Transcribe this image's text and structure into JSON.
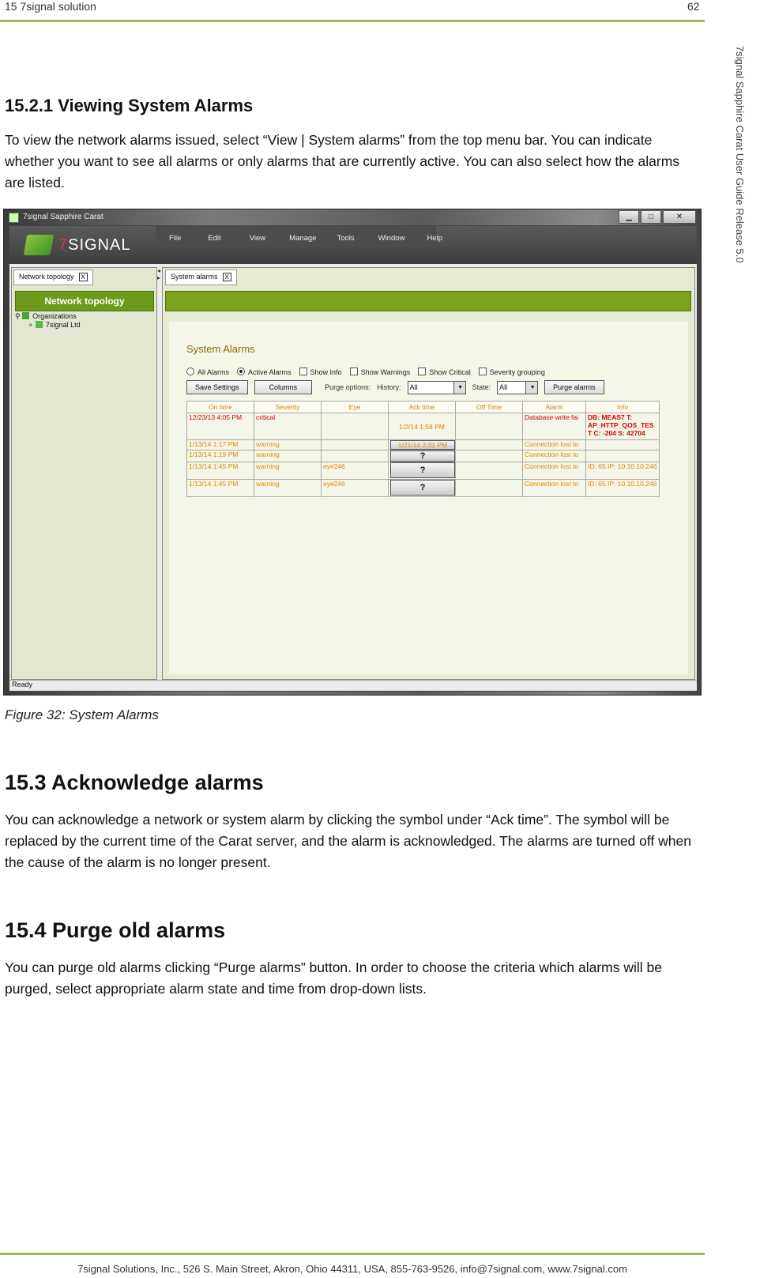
{
  "header": {
    "chapter": "15 7signal solution",
    "page": "62"
  },
  "sidebar_title": "7signal Sapphire Carat User Guide Release 5.0",
  "section_1521": {
    "heading": "15.2.1 Viewing System Alarms",
    "text": "To view the network alarms issued, select “View | System alarms” from the top menu bar. You can indicate whether you want to see all alarms or only alarms that are currently active. You can also select how the alarms are listed."
  },
  "screenshot": {
    "window_title": "7signal Sapphire Carat",
    "window_buttons": [
      "▁",
      "□",
      "✕"
    ],
    "logo_seven": "7",
    "logo_text": "SIGNAL",
    "menu": [
      "File",
      "Edit",
      "View",
      "Manage",
      "Tools",
      "Window",
      "Help"
    ],
    "left_tab": "Network topology",
    "left_header": "Network topology",
    "tree": {
      "root": "Organizations",
      "child": "7signal Ltd"
    },
    "right_tab": "System alarms",
    "tab_close": "X",
    "panel_title": "System Alarms",
    "options": {
      "all_alarms": "All Alarms",
      "active_alarms": "Active Alarms",
      "show_info": "Show Info",
      "show_warnings": "Show Warnings",
      "show_critical": "Show Critical",
      "severity_grouping": "Severity grouping"
    },
    "buttons": {
      "save_settings": "Save Settings",
      "columns": "Columns",
      "purge": "Purge alarms"
    },
    "purge_options_label": "Purge options:",
    "history_label": "History:",
    "history_value": "All",
    "state_label": "State:",
    "state_value": "All",
    "columns": [
      "On time",
      "Severity",
      "Eye",
      "Ack time",
      "Off Time",
      "Alarm",
      "Info"
    ],
    "rows": [
      {
        "on_time": "12/23/13 4:05 PM",
        "severity": "critical",
        "eye": "",
        "ack": "1/2/14 1:58 PM",
        "off": "",
        "alarm": "Database write fai",
        "info": "DB: MEAS7 T: AP_HTTP_QOS_TES T C: -204 S: 42704"
      },
      {
        "on_time": "1/13/14 1:17 PM",
        "severity": "warning",
        "eye": "",
        "ack": "1/21/14 2:31 PM",
        "off": "",
        "alarm": "Connection lost to",
        "info": ""
      },
      {
        "on_time": "1/13/14 1:19 PM",
        "severity": "warning",
        "eye": "",
        "ack": "?",
        "off": "",
        "alarm": "Connection lost to",
        "info": ""
      },
      {
        "on_time": "1/13/14 1:45 PM",
        "severity": "warning",
        "eye": "eye246",
        "ack": "?",
        "off": "",
        "alarm": "Connection lost to",
        "info": "ID: 65 IP: 10.10.10.246"
      },
      {
        "on_time": "1/13/14 1:45 PM",
        "severity": "warning",
        "eye": "eye246",
        "ack": "?",
        "off": "",
        "alarm": "Connection lost to",
        "info": "ID: 65 IP: 10.10.10.246"
      }
    ],
    "status": "Ready"
  },
  "caption": "Figure 32: System Alarms",
  "section_153": {
    "heading": "15.3 Acknowledge alarms",
    "text": "You can acknowledge a network or system alarm by clicking the symbol under “Ack time”. The symbol will be replaced by the current time of the Carat server, and the alarm is acknowledged. The alarms are turned off when the cause of the alarm is no longer present."
  },
  "section_154": {
    "heading": "15.4 Purge old alarms",
    "text": "You can purge old alarms clicking “Purge alarms” button. In order to choose the criteria which alarms will be purged, select appropriate alarm state and time from drop-down lists."
  },
  "footer": "7signal Solutions, Inc., 526 S. Main Street, Akron, Ohio 44311, USA, 855-763-9526, info@7signal.com, www.7signal.com",
  "colors": {
    "accent_rule": "#9bbb59",
    "app_green": "#7da31c",
    "critical": "#d40000",
    "warning": "#e08a00"
  }
}
